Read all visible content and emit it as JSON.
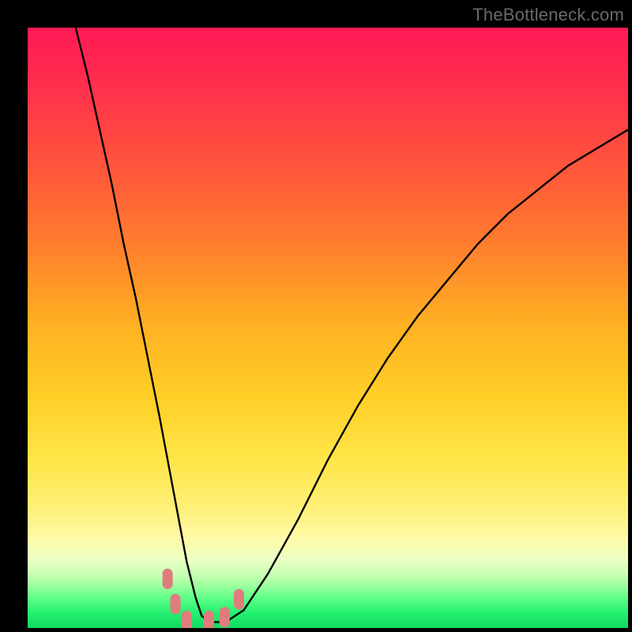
{
  "watermark": "TheBottleneck.com",
  "colors": {
    "black": "#000000",
    "curve": "#000000",
    "marker_fill": "#e07c7c",
    "gradient_stops": [
      {
        "offset": 0.0,
        "color": "#ff1a55"
      },
      {
        "offset": 0.07,
        "color": "#ff2850"
      },
      {
        "offset": 0.2,
        "color": "#ff4c3f"
      },
      {
        "offset": 0.35,
        "color": "#ff7a2e"
      },
      {
        "offset": 0.5,
        "color": "#ffb222"
      },
      {
        "offset": 0.62,
        "color": "#ffd028"
      },
      {
        "offset": 0.72,
        "color": "#ffe548"
      },
      {
        "offset": 0.8,
        "color": "#fff077"
      },
      {
        "offset": 0.85,
        "color": "#fffaa8"
      },
      {
        "offset": 0.885,
        "color": "#ecffc3"
      },
      {
        "offset": 0.91,
        "color": "#caffb6"
      },
      {
        "offset": 0.93,
        "color": "#9bff9e"
      },
      {
        "offset": 0.95,
        "color": "#5dff87"
      },
      {
        "offset": 0.975,
        "color": "#23f06f"
      },
      {
        "offset": 1.0,
        "color": "#0fd860"
      }
    ]
  },
  "chart_data": {
    "type": "line",
    "title": "",
    "xlabel": "",
    "ylabel": "",
    "xlim": [
      0,
      100
    ],
    "ylim": [
      0,
      100
    ],
    "note": "Bottleneck-style V curve. y axis inverted visually (low y = bottom/green). Curve values are % of vertical span from bottom (0) to top (100), estimated from pixels.",
    "series": [
      {
        "name": "bottleneck-curve",
        "x": [
          8,
          10,
          12,
          14,
          16,
          18,
          20,
          22,
          23.5,
          25,
          26.5,
          28,
          29,
          30.5,
          33,
          36,
          40,
          45,
          50,
          55,
          60,
          65,
          70,
          75,
          80,
          85,
          90,
          95,
          100
        ],
        "y": [
          100,
          92,
          83,
          74,
          64,
          55,
          45,
          35,
          27,
          19,
          11,
          5,
          2,
          1,
          1,
          3,
          9,
          18,
          28,
          37,
          45,
          52,
          58,
          64,
          69,
          73,
          77,
          80,
          83
        ]
      }
    ],
    "markers": {
      "name": "highlight-pills",
      "points": [
        {
          "x": 23.3,
          "y": 8.2
        },
        {
          "x": 24.6,
          "y": 4.0
        },
        {
          "x": 26.5,
          "y": 1.2
        },
        {
          "x": 30.2,
          "y": 1.2
        },
        {
          "x": 32.8,
          "y": 1.8
        },
        {
          "x": 35.2,
          "y": 4.8
        }
      ]
    }
  }
}
